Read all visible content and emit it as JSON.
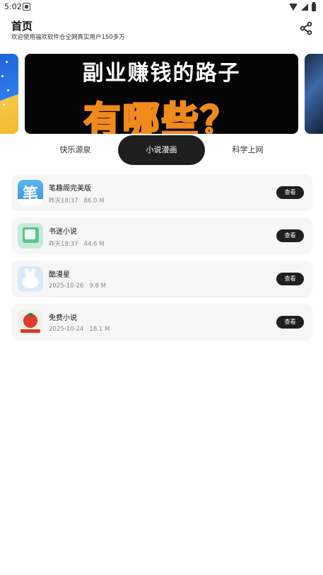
{
  "status_bar": {
    "time": "5:02"
  },
  "header": {
    "title": "首页",
    "subtitle": "欢迎使用福欢软件仓全网真实用户150多万"
  },
  "banner": {
    "line1": "副业赚钱的路子",
    "line2": "有哪些？"
  },
  "tabs": [
    {
      "label": "快乐源泉",
      "active": false
    },
    {
      "label": "小说漫画",
      "active": true
    },
    {
      "label": "科学上网",
      "active": false
    }
  ],
  "apps": [
    {
      "name": "笔趣阁完美版",
      "date": "昨天18:37",
      "size": "86.0 M",
      "button": "查看",
      "icon": "biquge-app-icon",
      "icon_glyph": "笔"
    },
    {
      "name": "书迷小说",
      "date": "昨天18:37",
      "size": "44.6 M",
      "button": "查看",
      "icon": "book-app-icon"
    },
    {
      "name": "酷漫星",
      "date": "2025-10-26",
      "size": "9.8 M",
      "button": "查看",
      "icon": "rabbit-app-icon"
    },
    {
      "name": "免费小说",
      "date": "2025-10-24",
      "size": "18.1 M",
      "button": "查看",
      "icon": "tomato-app-icon"
    }
  ],
  "colors": {
    "accent": "#1f1f1f",
    "card_bg": "#f6f6f6",
    "meta_text": "#8a8a8a"
  }
}
